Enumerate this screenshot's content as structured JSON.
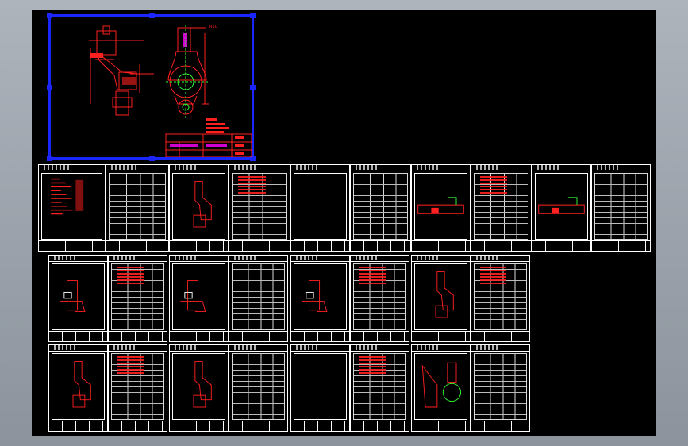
{
  "viewport": {
    "background": "#9aa1aa",
    "canvas": "#000000"
  },
  "colors": {
    "selection": "#1b26ff",
    "geometry": "#ff2020",
    "border": "#ffffff",
    "dimension": "#33ff33",
    "highlight": "#d000d0"
  },
  "main_drawing": {
    "label": "R10"
  },
  "sheets": [
    {
      "kind": "picture",
      "content": "notes"
    },
    {
      "kind": "table"
    },
    {
      "kind": "picture",
      "content": "part-view"
    },
    {
      "kind": "table"
    },
    {
      "kind": "picture",
      "content": "empty"
    },
    {
      "kind": "table"
    },
    {
      "kind": "picture",
      "content": "section"
    },
    {
      "kind": "table"
    },
    {
      "kind": "picture",
      "content": "section"
    },
    {
      "kind": "table"
    },
    {
      "kind": "picture",
      "content": "fixture"
    },
    {
      "kind": "table"
    },
    {
      "kind": "picture",
      "content": "fixture"
    },
    {
      "kind": "table"
    },
    {
      "kind": "picture",
      "content": "fixture"
    },
    {
      "kind": "table"
    },
    {
      "kind": "picture",
      "content": "part-view"
    },
    {
      "kind": "table"
    },
    {
      "kind": "picture",
      "content": "part-view"
    },
    {
      "kind": "table"
    },
    {
      "kind": "picture",
      "content": "part-view"
    },
    {
      "kind": "table"
    },
    {
      "kind": "picture",
      "content": "empty"
    },
    {
      "kind": "table"
    },
    {
      "kind": "picture",
      "content": "assembly"
    },
    {
      "kind": "table"
    }
  ]
}
